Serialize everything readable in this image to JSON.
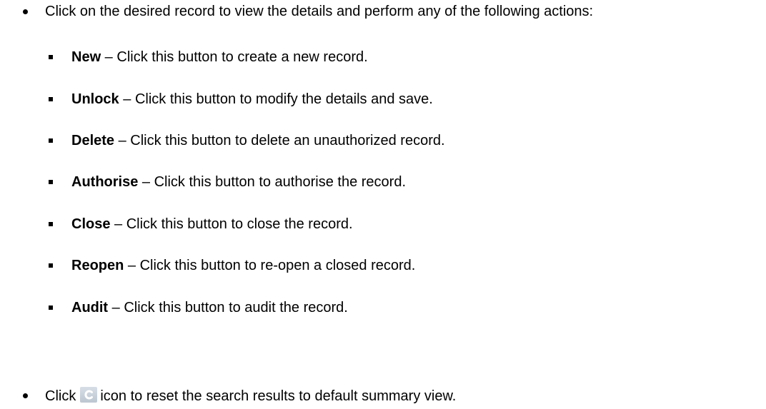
{
  "intro": "Click on the desired record to view the details and perform any of the following actions:",
  "actions": [
    {
      "term": "New",
      "sep": " – ",
      "desc": "Click this button to create a new record."
    },
    {
      "term": "Unlock",
      "sep": " – ",
      "desc": "Click this button to modify the details and save."
    },
    {
      "term": "Delete",
      "sep": " – ",
      "desc": "Click this button to delete an unauthorized record."
    },
    {
      "term": "Authorise",
      "sep": " – ",
      "desc": "Click this button to authorise the record."
    },
    {
      "term": "Close",
      "sep": " – ",
      "desc": "Click this button to close the record."
    },
    {
      "term": "Reopen",
      "sep": " – ",
      "desc": "Click this button to re-open a closed record."
    },
    {
      "term": "Audit",
      "sep": " – ",
      "desc": "Click this button to audit the record."
    }
  ],
  "reset": {
    "before": "Click",
    "icon": "reset-icon",
    "after": "icon to reset the search results to default summary view."
  }
}
